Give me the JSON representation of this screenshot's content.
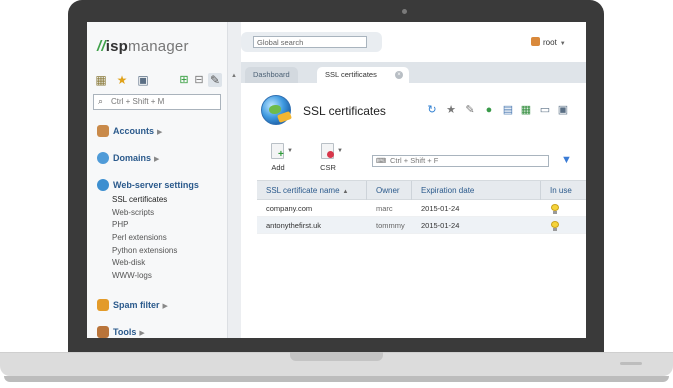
{
  "brand": {
    "mark": "//",
    "isp": "isp",
    "manager": "manager"
  },
  "sidebar": {
    "search_placeholder": "Ctrl + Shift + M",
    "tool_icons": [
      "grid-icon",
      "star-icon",
      "briefcase-icon",
      "expand-icon",
      "collapse-icon",
      "pin-icon"
    ],
    "menu": [
      {
        "label": "Accounts",
        "icon": "accounts-icon"
      },
      {
        "label": "Domains",
        "icon": "domains-icon"
      },
      {
        "label": "Web-server settings",
        "icon": "web-server-icon",
        "items": [
          "SSL certificates",
          "Web-scripts",
          "PHP",
          "Perl extensions",
          "Python extensions",
          "Web-disk",
          "WWW-logs"
        ]
      },
      {
        "label": "Spam filter",
        "icon": "spam-filter-icon"
      },
      {
        "label": "Tools",
        "icon": "tools-icon"
      }
    ]
  },
  "topbar": {
    "global_search_placeholder": "Global search",
    "user": "root"
  },
  "tabs": [
    {
      "label": "Dashboard",
      "active": false
    },
    {
      "label": "SSL certificates",
      "active": true
    }
  ],
  "page": {
    "title": "SSL certificates",
    "title_icons": [
      "refresh-icon",
      "star-icon",
      "pin-icon",
      "globe-icon",
      "copy-icon",
      "excel-icon",
      "print-icon",
      "settings-icon"
    ],
    "toolbar": {
      "add_label": "Add",
      "csr_label": "CSR",
      "filter_placeholder": "Ctrl + Shift + F"
    },
    "table": {
      "columns": [
        "SSL certificate name",
        "Owner",
        "Expiration date",
        "In use"
      ],
      "rows": [
        {
          "name": "company.com",
          "owner": "marc",
          "expiration": "2015-01-24",
          "in_use": true
        },
        {
          "name": "antonythefirst.uk",
          "owner": "tommmy",
          "expiration": "2015-01-24",
          "in_use": true
        }
      ]
    }
  },
  "colors": {
    "link": "#2b5a8c",
    "brand_green": "#3fa14a",
    "laptop_frame": "#3a3a3a"
  }
}
